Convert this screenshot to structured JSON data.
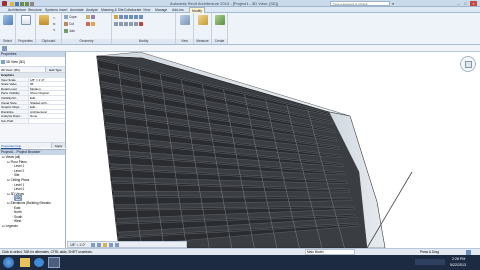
{
  "window": {
    "title": "Autodesk Revit Architecture 2013 - [Project1 - 3D View: {3D}]",
    "search_placeholder": "Type a keyword or phrase"
  },
  "tabs": [
    {
      "label": "Architecture"
    },
    {
      "label": "Structure"
    },
    {
      "label": "Systems"
    },
    {
      "label": "Insert"
    },
    {
      "label": "Annotate"
    },
    {
      "label": "Analyze"
    },
    {
      "label": "Massing & Site"
    },
    {
      "label": "Collaborate"
    },
    {
      "label": "View"
    },
    {
      "label": "Manage"
    },
    {
      "label": "Add-Ins"
    },
    {
      "label": "Modify"
    }
  ],
  "ribbon": {
    "select": "Select",
    "properties": "Properties",
    "clipboard": "Clipboard",
    "geometry": "Geometry",
    "modify": "Modify",
    "view": "View",
    "measure": "Measure",
    "create": "Create",
    "cope": "Cope",
    "cut": "Cut",
    "join": "Join",
    "paste": "Paste"
  },
  "properties": {
    "header": "Properties",
    "type": "3D View (3D)",
    "instance": "3D View: {3D}",
    "edit_type": "Edit Type",
    "group_graphics": "Graphics",
    "rows": [
      {
        "k": "View Scale",
        "v": "1/8\" = 1'-0\""
      },
      {
        "k": "Scale Value",
        "v": "96"
      },
      {
        "k": "Detail Level",
        "v": "Medium"
      },
      {
        "k": "Parts Visibility",
        "v": "Show Original"
      },
      {
        "k": "Visibility/Gr...",
        "v": "Edit..."
      },
      {
        "k": "Visual Style",
        "v": "Shaded with..."
      },
      {
        "k": "Graphic Displ...",
        "v": "Edit..."
      },
      {
        "k": "Discipline",
        "v": "Architectural"
      },
      {
        "k": "Analysis Displ...",
        "v": "None"
      },
      {
        "k": "Sun Path",
        "v": ""
      }
    ],
    "help": "Properties help",
    "apply": "Apply"
  },
  "browser": {
    "header": "Project1 - Project Browser",
    "items": [
      {
        "label": "Views (all)",
        "level": 0
      },
      {
        "label": "Floor Plans",
        "level": 1
      },
      {
        "label": "Level 1",
        "level": 2
      },
      {
        "label": "Level 2",
        "level": 2
      },
      {
        "label": "Site",
        "level": 2
      },
      {
        "label": "Ceiling Plans",
        "level": 1
      },
      {
        "label": "Level 1",
        "level": 2
      },
      {
        "label": "Level 2",
        "level": 2
      },
      {
        "label": "3D Views",
        "level": 1
      },
      {
        "label": "{3D}",
        "level": 2
      },
      {
        "label": "Elevations (Building Elevatio",
        "level": 1
      },
      {
        "label": "East",
        "level": 2
      },
      {
        "label": "North",
        "level": 2
      },
      {
        "label": "South",
        "level": 2
      },
      {
        "label": "West",
        "level": 2
      },
      {
        "label": "Legends",
        "level": 0
      }
    ]
  },
  "viewbar": {
    "scale": "1/8\" = 1'-0\""
  },
  "status": {
    "text": "Click to select, TAB for alternates, CTRL adds, SHIFT unselects.",
    "press_drag": "Press & Drag",
    "model": "Main Model"
  },
  "taskbar": {
    "time": "2:28 PM",
    "date": "5/22/2013"
  },
  "colors": {
    "accent": "#c9daea",
    "panel": "#eef3f9",
    "curtain": "#3a3d42"
  },
  "facade": {
    "bands": 14
  }
}
